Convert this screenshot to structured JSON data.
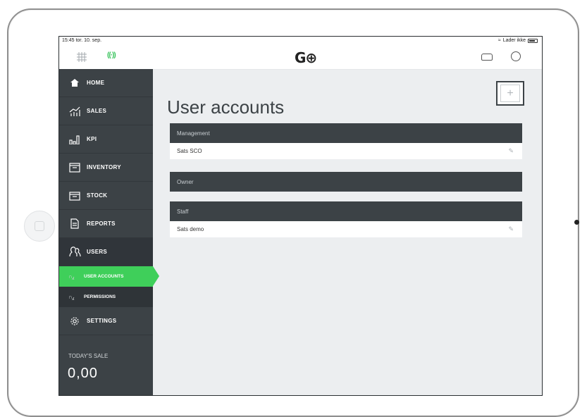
{
  "status": {
    "time_date": "15:45  tor. 10. sep.",
    "battery_text": "Lader ikke"
  },
  "topbar": {
    "logo": "G⊕"
  },
  "sidebar": {
    "items": [
      {
        "label": "HOME",
        "icon": "home-icon"
      },
      {
        "label": "SALES",
        "icon": "sales-chart-icon"
      },
      {
        "label": "KPI",
        "icon": "kpi-bars-icon"
      },
      {
        "label": "INVENTORY",
        "icon": "inventory-box-icon"
      },
      {
        "label": "STOCK",
        "icon": "stock-box-icon"
      },
      {
        "label": "REPORTS",
        "icon": "reports-document-icon"
      },
      {
        "label": "USERS",
        "icon": "users-icon"
      }
    ],
    "subitems": [
      {
        "label": "USER ACCOUNTS",
        "active": true
      },
      {
        "label": "PERMISSIONS",
        "active": false
      }
    ],
    "settings": {
      "label": "SETTINGS"
    },
    "today_label": "TODAY'S SALE",
    "today_value": "0,00"
  },
  "main": {
    "title": "User accounts",
    "add_symbol": "+",
    "groups": [
      {
        "name": "Management",
        "users": [
          "Sats SCO"
        ]
      },
      {
        "name": "Owner",
        "users": []
      },
      {
        "name": "Staff",
        "users": [
          "Sats demo"
        ]
      }
    ]
  },
  "colors": {
    "accent": "#3fcf5a",
    "sidebar": "#3c4246",
    "background": "#eceef0"
  }
}
